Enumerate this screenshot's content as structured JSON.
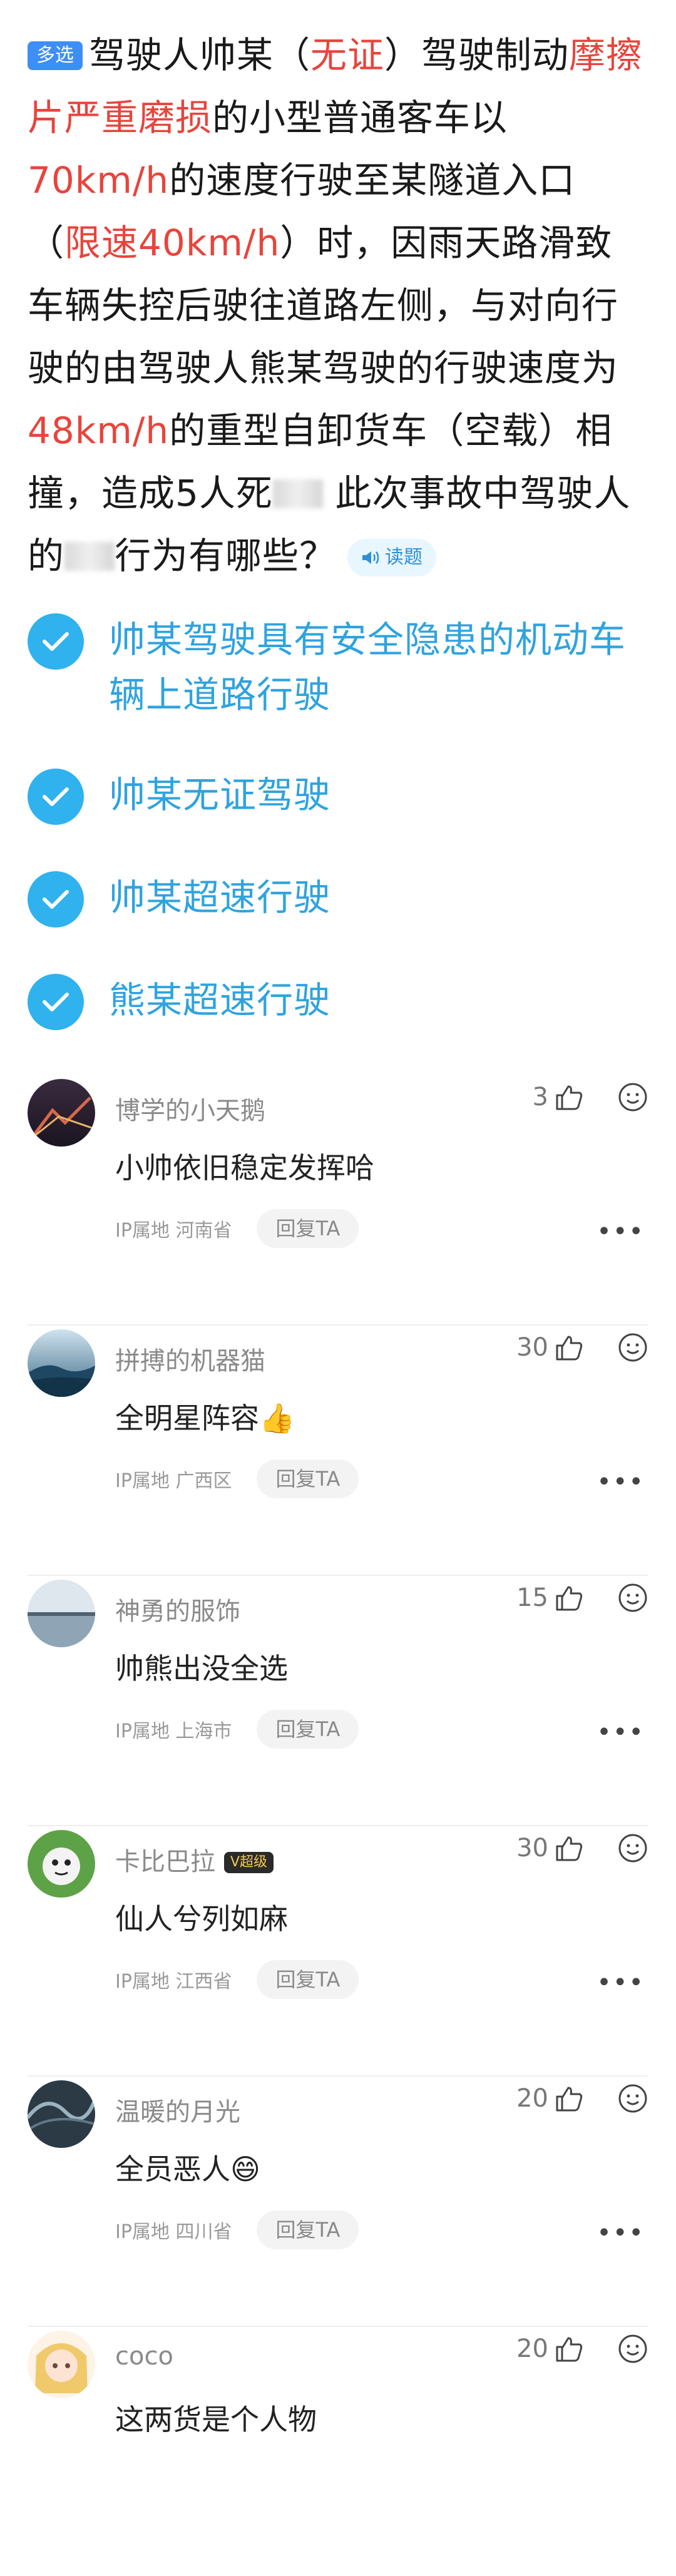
{
  "question": {
    "tag": "多选",
    "segments": [
      {
        "text": "驾驶人帅某（",
        "color": "normal"
      },
      {
        "text": "无证",
        "color": "red"
      },
      {
        "text": "）驾驶制动",
        "color": "normal"
      },
      {
        "text": "摩擦片严重磨损",
        "color": "red"
      },
      {
        "text": "的小型普通客车以",
        "color": "normal"
      },
      {
        "text": "70km/h",
        "color": "red"
      },
      {
        "text": "的速度行驶至某隧道入口（",
        "color": "normal"
      },
      {
        "text": "限速40km/h",
        "color": "red"
      },
      {
        "text": "）时，因雨天路滑致车辆失控后驶往道路左侧，与对向行驶的由驾驶人熊某驾驶的行驶速度为",
        "color": "normal"
      },
      {
        "text": "48km/h",
        "color": "red"
      },
      {
        "text": "的重型自卸货车（空载）相撞，造成5人死",
        "color": "normal"
      },
      {
        "text": "",
        "color": "blur"
      },
      {
        "text": " 此次事故中驾驶人的",
        "color": "normal"
      },
      {
        "text": "",
        "color": "blur"
      },
      {
        "text": "行为有哪些？",
        "color": "normal"
      }
    ],
    "read_button": "读题"
  },
  "options": [
    {
      "label": "帅某驾驶具有安全隐患的机动车辆上道路行驶",
      "checked": true
    },
    {
      "label": "帅某无证驾驶",
      "checked": true
    },
    {
      "label": "帅某超速行驶",
      "checked": true
    },
    {
      "label": "熊某超速行驶",
      "checked": true
    }
  ],
  "comments": [
    {
      "name": "博学的小天鹅",
      "likes": "3",
      "text": "小帅依旧稳定发挥哈",
      "ip": "IP属地 河南省",
      "reply": "回复TA",
      "avatar": "night-city",
      "badge": ""
    },
    {
      "name": "拼搏的机器猫",
      "likes": "30",
      "text": "全明星阵容👍",
      "ip": "IP属地 广西区",
      "reply": "回复TA",
      "avatar": "blue-mountain",
      "badge": ""
    },
    {
      "name": "神勇的服饰",
      "likes": "15",
      "text": "帅熊出没全选",
      "ip": "IP属地 上海市",
      "reply": "回复TA",
      "avatar": "lake-horizon",
      "badge": ""
    },
    {
      "name": "卡比巴拉",
      "likes": "30",
      "text": "仙人兮列如麻",
      "ip": "IP属地 江西省",
      "reply": "回复TA",
      "avatar": "green-cartoon",
      "badge": "V超级"
    },
    {
      "name": "温暖的月光",
      "likes": "20",
      "text": "全员恶人😄",
      "ip": "IP属地 四川省",
      "reply": "回复TA",
      "avatar": "dark-wave",
      "badge": ""
    },
    {
      "name": "coco",
      "likes": "20",
      "text": "这两货是个人物",
      "ip": "",
      "reply": "",
      "avatar": "anime-girl",
      "badge": ""
    }
  ]
}
